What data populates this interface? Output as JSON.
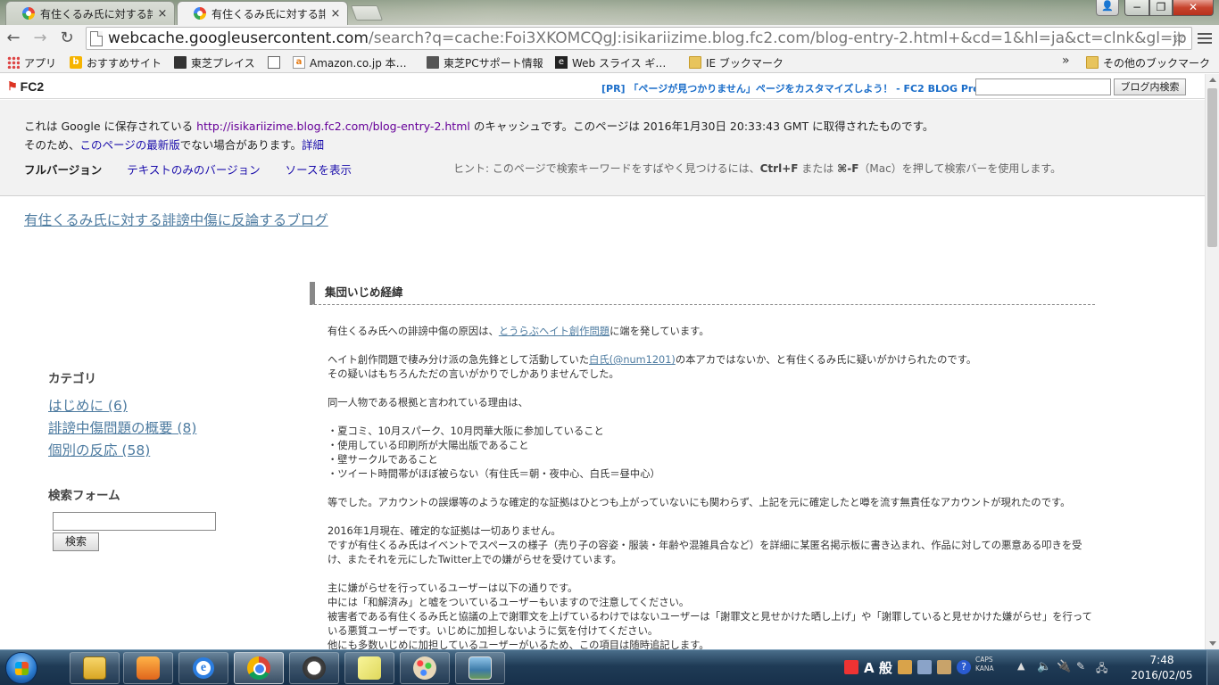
{
  "browser": {
    "tabs": [
      {
        "title": "有住くるみ氏に対する誹謗",
        "state": "inactive"
      },
      {
        "title": "有住くるみ氏に対する誹謗",
        "state": "active"
      }
    ],
    "tab_close": "×",
    "url_host": "webcache.googleusercontent.com",
    "url_rest": "/search?q=cache:Foi3XKOMCQgJ:isikariizime.blog.fc2.com/blog-entry-2.html+&cd=1&hl=ja&ct=clnk&gl=jp",
    "nav": {
      "back": "←",
      "forward": "→",
      "reload": "↻",
      "star": "☆"
    },
    "window_controls": {
      "minimize": "−",
      "maximize": "❐",
      "close": "✕",
      "user": "👤"
    }
  },
  "bookmarks": {
    "items": [
      {
        "label": "アプリ",
        "icon": "apps-icon"
      },
      {
        "label": "おすすめサイト",
        "icon": "bing-icon"
      },
      {
        "label": "東芝プレイス",
        "icon": "toshiba-icon"
      },
      {
        "label": "",
        "icon": "page-icon"
      },
      {
        "label": "Amazon.co.jp 本…",
        "icon": "amazon-icon"
      },
      {
        "label": "東芝PCサポート情報",
        "icon": "pc-icon"
      },
      {
        "label": "Web スライス ギ…",
        "icon": "webslice-icon"
      },
      {
        "label": "IE ブックマーク",
        "icon": "folder-icon"
      }
    ],
    "more": "»",
    "other": "その他のブックマーク"
  },
  "fc2": {
    "logo": "FC2",
    "promo": "[PR] 「ページが見つかりません」ページをカスタマイズしよう！ - FC2 BLOG Pro",
    "search_button": "ブログ内検索"
  },
  "cache": {
    "line1_pre": "これは Google に保存されている ",
    "cached_url": "http://isikariizime.blog.fc2.com/blog-entry-2.html",
    "line1_post": " のキャッシュです。このページは 2016年1月30日 20:33:43 GMT に取得されたものです。",
    "line2_pre": "そのため、",
    "latest_link": "このページの最新版",
    "line2_mid": "でない場合があります。",
    "details_link": "詳細",
    "full_version": "フルバージョン",
    "text_version": "テキストのみのバージョン",
    "view_source": "ソースを表示",
    "hint_pre": "ヒント: このページで検索キーワードをすばやく見つけるには、",
    "hint_key1": "Ctrl+F",
    "hint_mid": " または ",
    "hint_key2": "⌘-F",
    "hint_post": "（Mac）を押して検索バーを使用します。"
  },
  "blog": {
    "title": "有住くるみ氏に対する誹謗中傷に反論するブログ",
    "sidebar": {
      "category_heading": "カテゴリ",
      "categories": [
        "はじめに (6)",
        "誹謗中傷問題の概要 (8)",
        "個別の反応 (58)"
      ],
      "search_heading": "検索フォーム",
      "search_button": "検索"
    },
    "entry": {
      "title": "集団いじめ経緯",
      "p1_pre": "有住くるみ氏への誹謗中傷の原因は、",
      "p1_link": "とうらぶヘイト創作問題",
      "p1_post": "に端を発しています。",
      "p2_l1_pre": "ヘイト創作問題で棲み分け派の急先鋒として活動していた",
      "p2_link": "白氏(@num1201)",
      "p2_l1_post": "の本アカではないか、と有住くるみ氏に疑いがかけられたのです。",
      "p2_l2": "その疑いはもちろんただの言いがかりでしかありませんでした。",
      "p3": "同一人物である根拠と言われている理由は、",
      "reasons": [
        "・夏コミ、10月スパーク、10月閃華大阪に参加していること",
        "・使用している印刷所が大陽出版であること",
        "・壁サークルであること",
        "・ツイート時間帯がほぼ被らない（有住氏＝朝・夜中心、白氏＝昼中心）"
      ],
      "p5": "等でした。アカウントの誤爆等のような確定的な証拠はひとつも上がっていないにも関わらず、上記を元に確定したと噂を流す無責任なアカウントが現れたのです。",
      "p6": [
        "2016年1月現在、確定的な証拠は一切ありません。",
        "ですが有住くるみ氏はイベントでスペースの様子（売り子の容姿・服装・年齢や混雑具合など）を詳細に某匿名掲示板に書き込まれ、作品に対しての悪意ある叩きを受",
        "け、またそれを元にしたTwitter上での嫌がらせを受けています。"
      ],
      "p7": [
        "主に嫌がらせを行っているユーザーは以下の通りです。",
        "中には「和解済み」と嘘をついているユーザーもいますので注意してください。",
        "被害者である有住くるみ氏と協議の上で謝罪文を上げているわけではないユーザーは「謝罪文と見せかけた晒し上げ」や「謝罪していると見せかけた嫌がらせ」を行って",
        "いる悪質ユーザーです。いじめに加担しないように気を付けてください。",
        "他にも多数いじめに加担しているユーザーがいるため、この項目は随時追記します。"
      ]
    }
  },
  "taskbar": {
    "ime_mode": "A 般",
    "caps_line1": "CAPS",
    "caps_line2": "KANA",
    "time": "7:48",
    "date": "2016/02/05"
  }
}
